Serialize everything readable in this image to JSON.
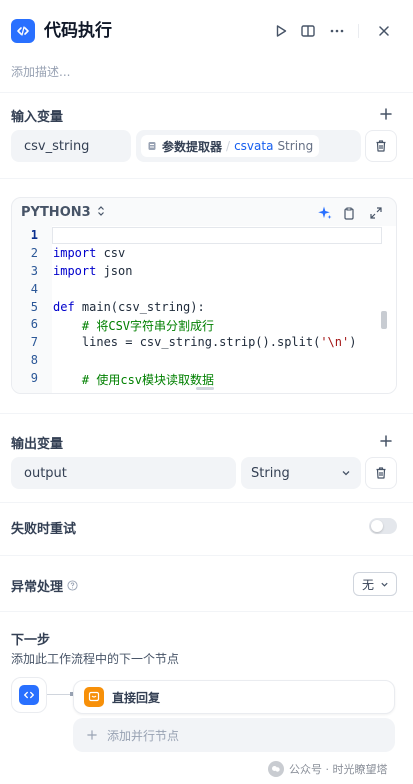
{
  "header": {
    "title": "代码执行",
    "description_placeholder": "添加描述..."
  },
  "input_section": {
    "title": "输入变量",
    "variable_name": "csv_string",
    "source_node": "参数提取器",
    "source_var": "csvata",
    "source_type": "String"
  },
  "editor": {
    "language": "PYTHON3",
    "line_numbers": [
      "1",
      "2",
      "3",
      "4",
      "5",
      "6",
      "7",
      "8",
      "9"
    ]
  },
  "output_section": {
    "title": "输出变量",
    "variable_name": "output",
    "type": "String"
  },
  "retry": {
    "title": "失败时重试",
    "enabled": false
  },
  "error_handling": {
    "title": "异常处理",
    "value": "无"
  },
  "next_step": {
    "title": "下一步",
    "subtitle": "添加此工作流程中的下一个节点",
    "node_label": "直接回复",
    "add_parallel": "添加并行节点"
  },
  "watermark": "公众号 · 时光瞭望塔",
  "colors": {
    "accent": "#2970ff",
    "reply_node": "#f79009"
  }
}
